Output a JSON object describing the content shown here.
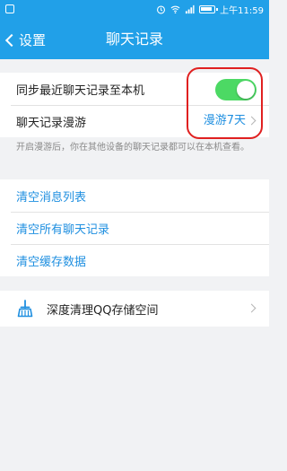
{
  "status_bar": {
    "time": "上午11:59"
  },
  "nav": {
    "back_label": "设置",
    "title": "聊天记录"
  },
  "group1": {
    "sync_label": "同步最近聊天记录至本机",
    "sync_enabled": true,
    "roaming_label": "聊天记录漫游",
    "roaming_value": "漫游7天"
  },
  "info_text": "开启漫游后，你在其他设备的聊天记录都可以在本机查看。",
  "group2": {
    "items": [
      {
        "label": "清空消息列表"
      },
      {
        "label": "清空所有聊天记录"
      },
      {
        "label": "清空缓存数据"
      }
    ]
  },
  "group3": {
    "deep_clean_label": "深度清理QQ存储空间"
  },
  "colors": {
    "accent": "#21a0e8",
    "link": "#1f8fe0",
    "toggle_on": "#4cd964",
    "highlight": "#e02020"
  }
}
